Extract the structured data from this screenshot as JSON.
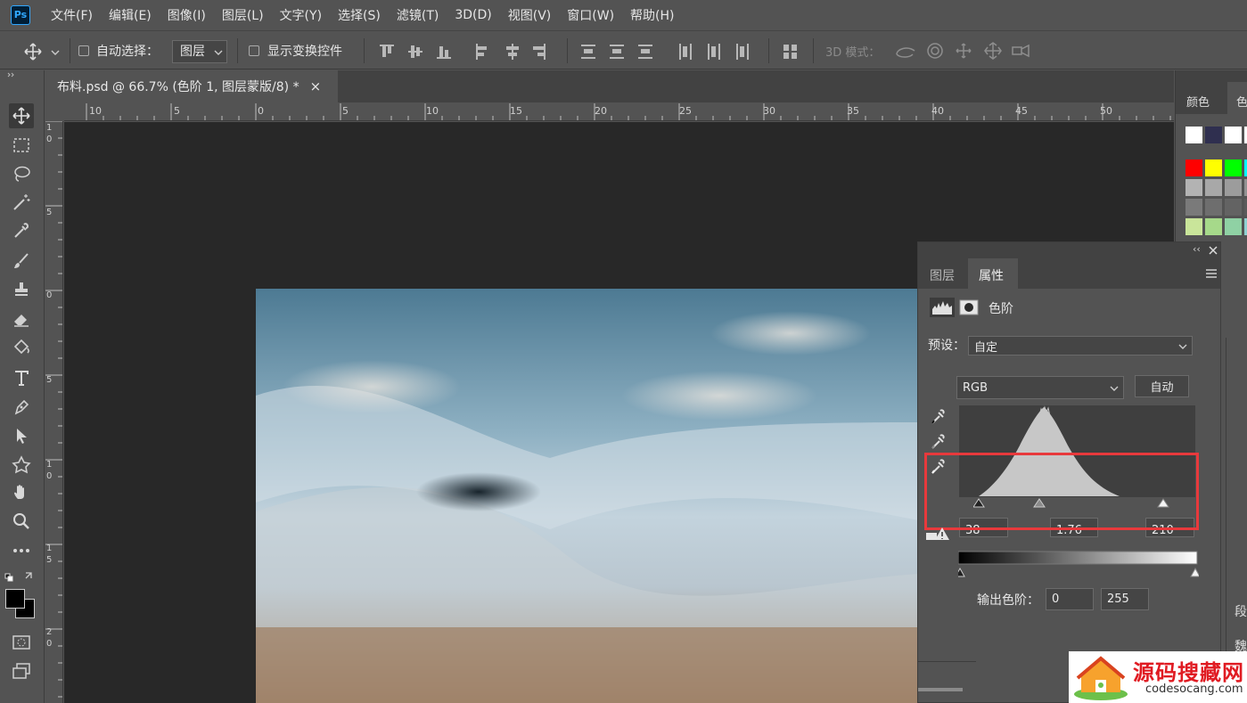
{
  "app": {
    "logo": "Ps"
  },
  "menu": [
    "文件(F)",
    "编辑(E)",
    "图像(I)",
    "图层(L)",
    "文字(Y)",
    "选择(S)",
    "滤镜(T)",
    "3D(D)",
    "视图(V)",
    "窗口(W)",
    "帮助(H)"
  ],
  "options": {
    "auto_select_label": "自动选择：",
    "auto_select_target": "图层",
    "show_transform_label": "显示变换控件",
    "mode_3d_label": "3D 模式："
  },
  "document": {
    "tab_title": "布料.psd @ 66.7% (色阶 1, 图层蒙版/8) *",
    "close_glyph": "×",
    "ruler_h": [
      "10",
      "5",
      "0",
      "5",
      "10",
      "15",
      "20",
      "25",
      "30",
      "35",
      "40",
      "45",
      "50"
    ],
    "ruler_v": [
      "1",
      "0",
      "5",
      "0",
      "5",
      "1",
      "0",
      "1",
      "5",
      "2",
      "0"
    ]
  },
  "right_panel": {
    "tab_color": "颜色",
    "tab_swatch_partial": "色",
    "side_text_1": "段",
    "side_text_2": "魏",
    "swatch_colors": [
      "#ffffff",
      "#2f2f4f",
      "#ffffff",
      "#ffffff",
      "#ff0000",
      "#ffff00",
      "#00ff00",
      "#00ffff",
      "#b3b3b3",
      "#a8a8a8",
      "#9c9c9c",
      "#929292",
      "#7a7a7a",
      "#6e6e6e",
      "#636363",
      "#5a5a5a",
      "#c9e59a",
      "#a6d98a",
      "#8fd1a4",
      "#8fd1d1"
    ]
  },
  "properties": {
    "tab_layers": "图层",
    "tab_properties": "属性",
    "adjustment_title": "色阶",
    "preset_label": "预设：",
    "preset_value": "自定",
    "channel_value": "RGB",
    "auto_button": "自动",
    "input_black": "38",
    "input_gamma": "1.76",
    "input_white": "210",
    "output_label": "输出色阶：",
    "output_black": "0",
    "output_white": "255"
  },
  "watermark": {
    "title": "源码搜藏网",
    "url": "codesocang.com"
  }
}
